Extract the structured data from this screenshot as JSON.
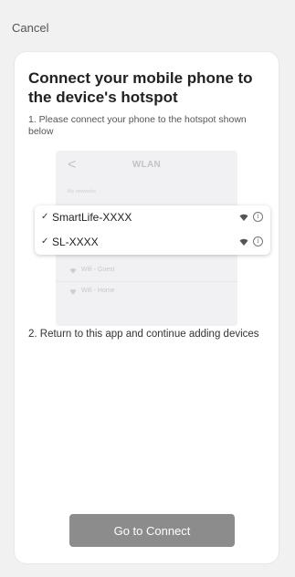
{
  "header": {
    "cancel_label": "Cancel"
  },
  "card": {
    "title": "Connect your mobile phone to the device's hotspot",
    "step1": "1. Please connect your phone to the hotspot shown below",
    "illustration": {
      "back_glyph": "<",
      "screen_title": "WLAN",
      "section_label": "My networks",
      "highlighted_networks": [
        {
          "check": "✓",
          "name": "SmartLife-XXXX",
          "info": "i"
        },
        {
          "check": "✓",
          "name": "SL-XXXX",
          "info": "i"
        }
      ],
      "other_networks": [
        {
          "name": "Wifi - Guest"
        },
        {
          "name": "Wifi - Home"
        }
      ]
    },
    "step2": "2. Return to this app and continue adding devices",
    "button_label": "Go to Connect"
  },
  "colors": {
    "page_background": "#f1f1f1",
    "card_background": "#ffffff",
    "button_background": "#8c8c8c",
    "button_text": "#ffffff"
  },
  "icons": {
    "back": "chevron-left-icon",
    "check": "checkmark-icon",
    "wifi": "wifi-icon",
    "info": "info-icon"
  }
}
